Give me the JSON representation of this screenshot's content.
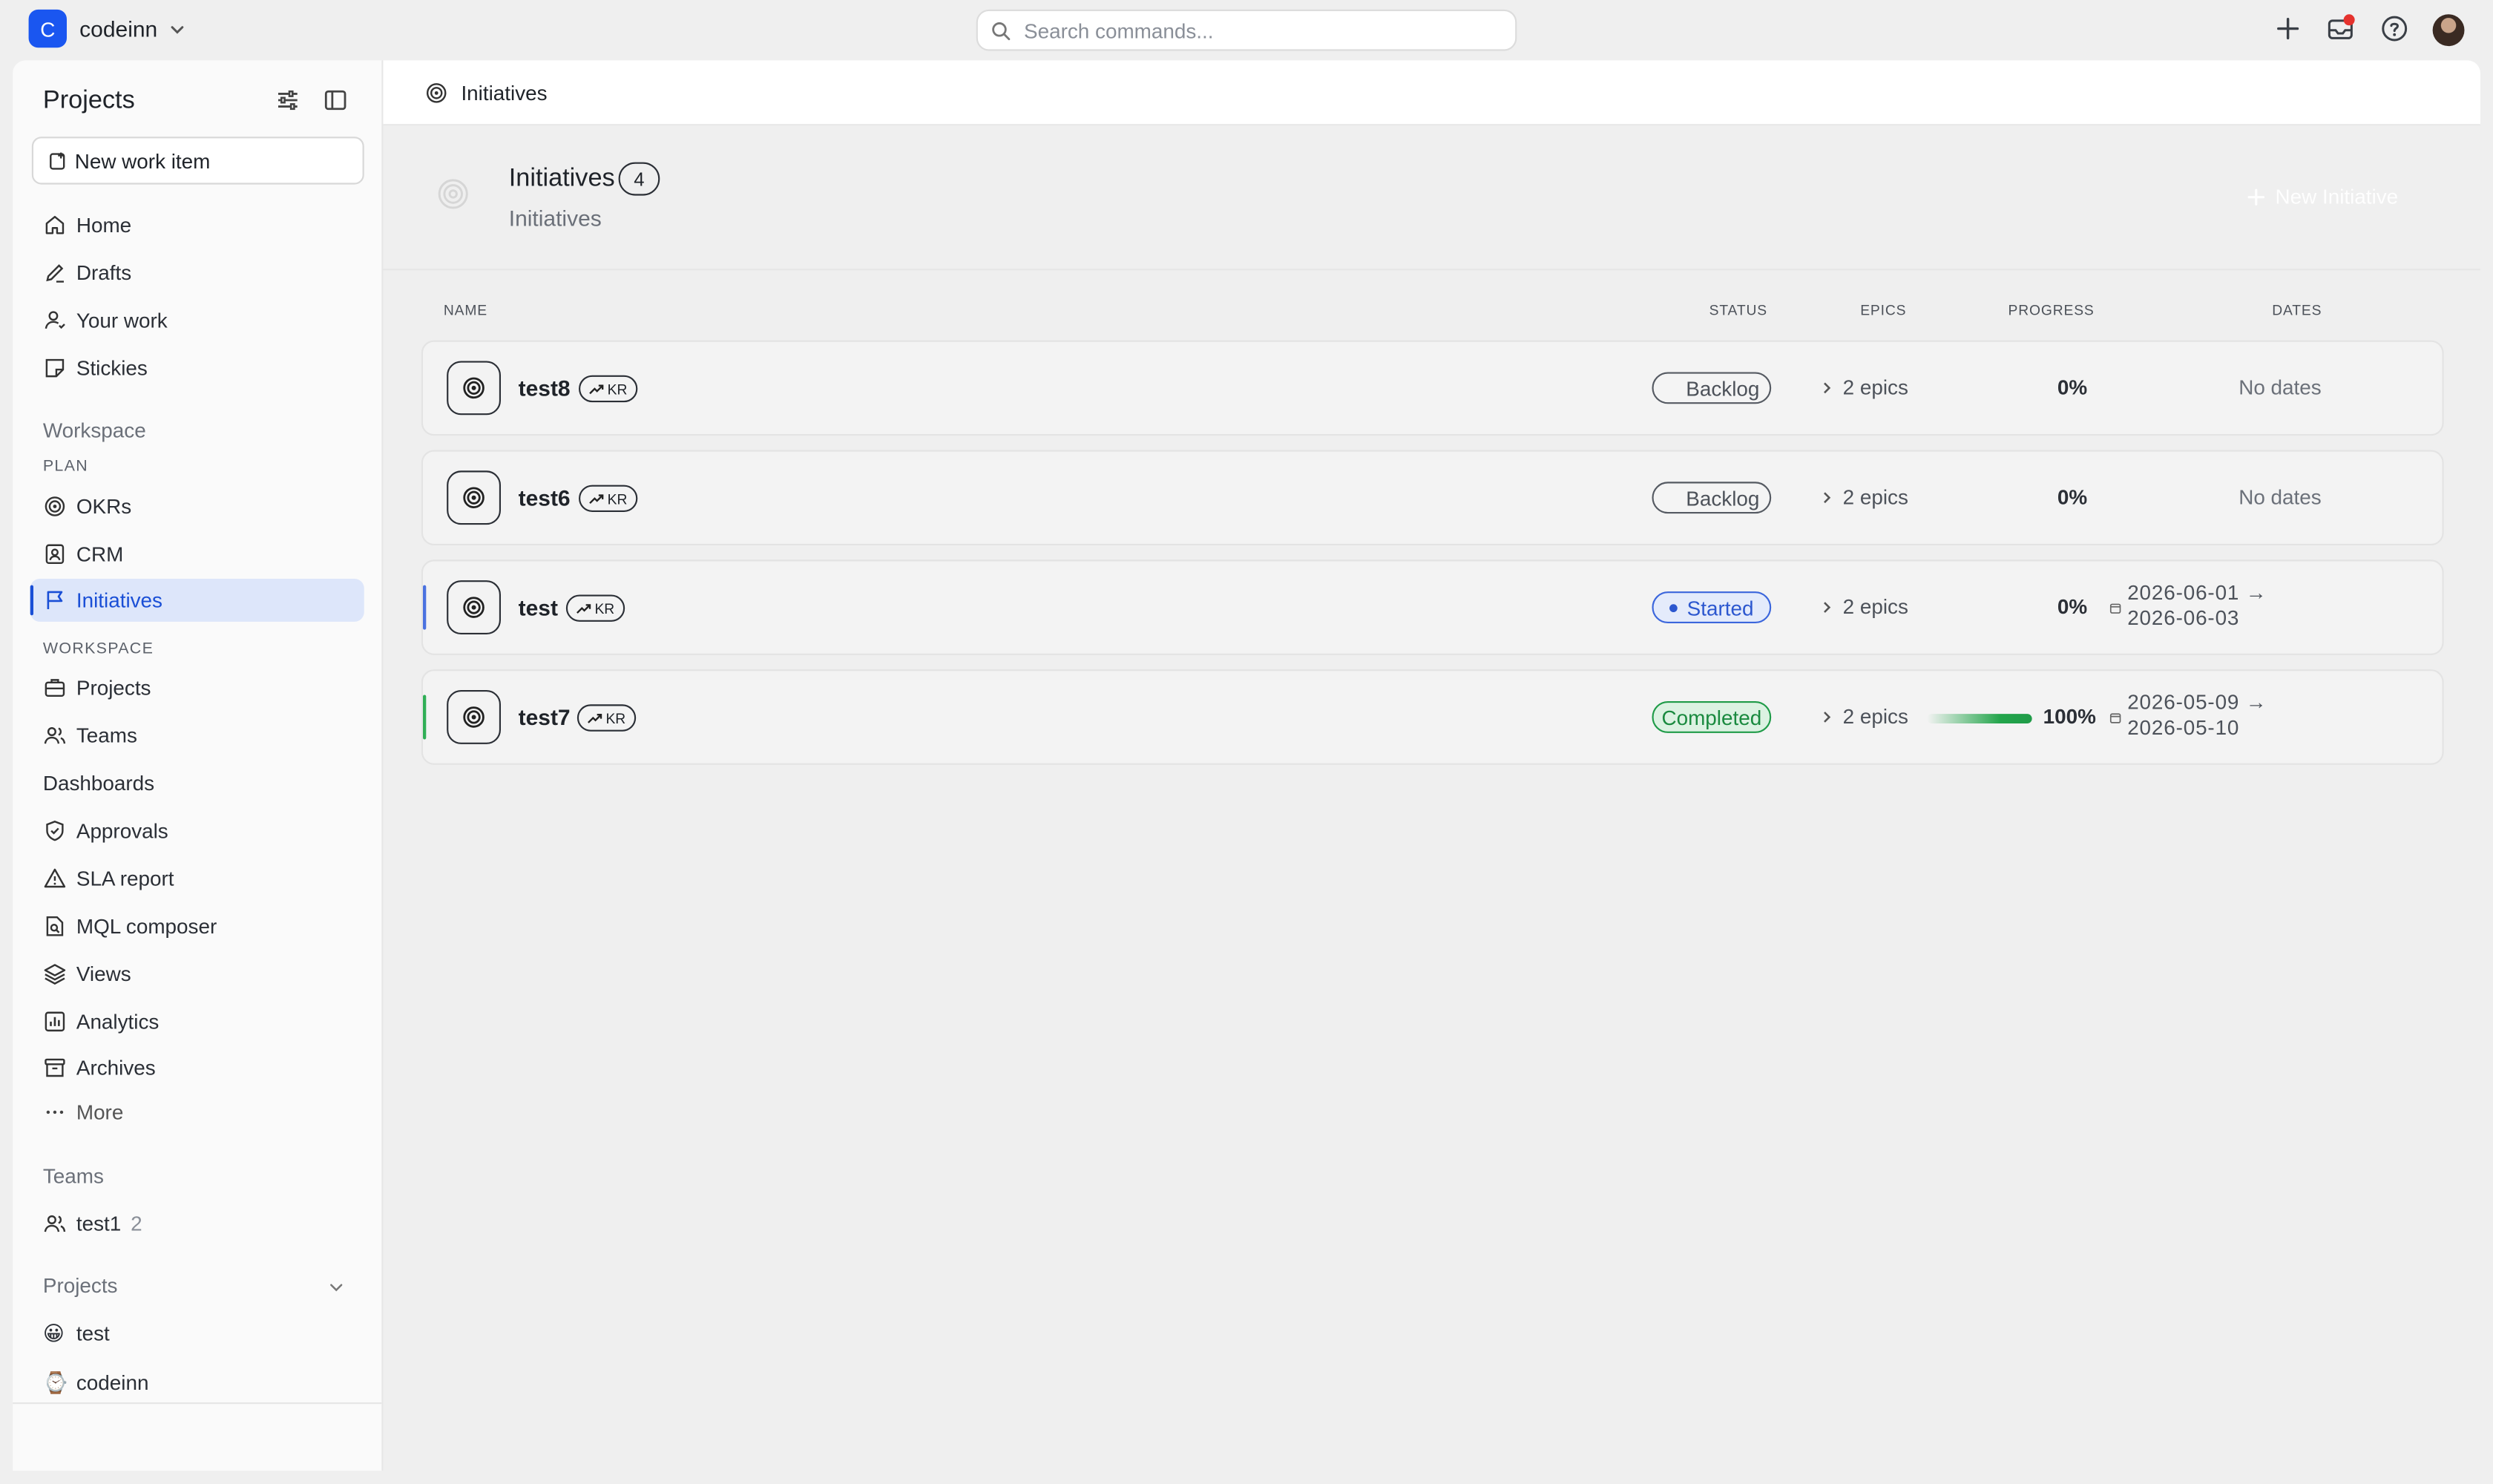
{
  "workspace": {
    "initial": "C",
    "name": "codeinn"
  },
  "search": {
    "placeholder": "Search commands..."
  },
  "sidebar": {
    "title": "Projects",
    "new_item": "New work item",
    "top_items": [
      {
        "label": "Home",
        "icon": "home-icon"
      },
      {
        "label": "Drafts",
        "icon": "pencil-icon"
      },
      {
        "label": "Your work",
        "icon": "user-icon"
      },
      {
        "label": "Stickies",
        "icon": "sticky-note-icon"
      }
    ],
    "workspace_heading": "Workspace",
    "plan_caption": "PLAN",
    "plan_items": [
      {
        "label": "OKRs",
        "icon": "target-icon"
      },
      {
        "label": "CRM",
        "icon": "contact-icon"
      },
      {
        "label": "Initiatives",
        "icon": "flag-icon",
        "active": true
      }
    ],
    "workspace_caption": "WORKSPACE",
    "workspace_items": [
      {
        "label": "Projects",
        "icon": "briefcase-icon"
      },
      {
        "label": "Teams",
        "icon": "users-icon"
      },
      {
        "label": "Dashboards",
        "icon": ""
      },
      {
        "label": "Approvals",
        "icon": "shield-check-icon"
      },
      {
        "label": "SLA report",
        "icon": "warning-icon"
      },
      {
        "label": "MQL composer",
        "icon": "file-search-icon"
      },
      {
        "label": "Views",
        "icon": "layers-icon"
      },
      {
        "label": "Analytics",
        "icon": "bar-chart-icon"
      },
      {
        "label": "Archives",
        "icon": "archive-icon"
      },
      {
        "label": "More",
        "icon": "ellipsis-icon"
      }
    ],
    "teams_heading": "Teams",
    "teams": [
      {
        "label": "test1",
        "count": "2"
      }
    ],
    "projects_heading": "Projects",
    "projects": [
      {
        "label": "test",
        "emoji": "😀"
      },
      {
        "label": "codeinn",
        "emoji": "⌚"
      }
    ]
  },
  "main": {
    "breadcrumb": "Initiatives",
    "title": "Initiatives",
    "count": "4",
    "subtitle": "Initiatives",
    "new_button": "New Initiative",
    "columns": {
      "name": "NAME",
      "status": "STATUS",
      "epics": "EPICS",
      "progress": "PROGRESS",
      "dates": "DATES"
    },
    "rows": [
      {
        "name": "test8",
        "tag": "KR",
        "status": "Backlog",
        "status_kind": "backlog",
        "epics": "2 epics",
        "progress": "0%",
        "progress_value": 0,
        "dates": "No dates"
      },
      {
        "name": "test6",
        "tag": "KR",
        "status": "Backlog",
        "status_kind": "backlog",
        "epics": "2 epics",
        "progress": "0%",
        "progress_value": 0,
        "dates": "No dates"
      },
      {
        "name": "test",
        "tag": "KR",
        "status": "Started",
        "status_kind": "started",
        "epics": "2 epics",
        "progress": "0%",
        "progress_value": 0,
        "start": "2026-06-01 →",
        "end": "2026-06-03"
      },
      {
        "name": "test7",
        "tag": "KR",
        "status": "Completed",
        "status_kind": "completed",
        "epics": "2 epics",
        "progress": "100%",
        "progress_value": 100,
        "start": "2026-05-09 →",
        "end": "2026-05-10"
      }
    ]
  },
  "colors": {
    "accent": "#1a56f0",
    "started": "#2c57cf",
    "completed": "#1f9b48",
    "notification": "#e5322d"
  }
}
